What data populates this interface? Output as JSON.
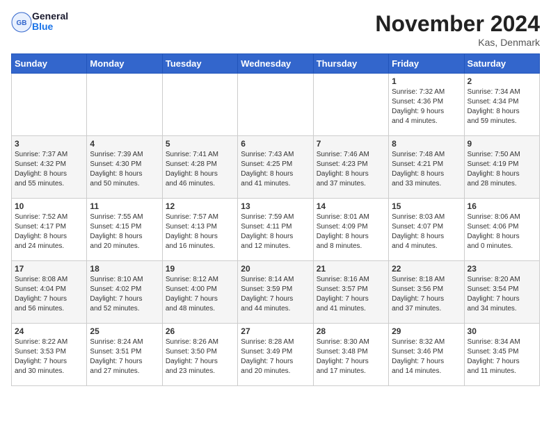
{
  "logo": {
    "line1": "General",
    "line2": "Blue"
  },
  "title": "November 2024",
  "location": "Kas, Denmark",
  "days_of_week": [
    "Sunday",
    "Monday",
    "Tuesday",
    "Wednesday",
    "Thursday",
    "Friday",
    "Saturday"
  ],
  "weeks": [
    [
      {
        "day": "",
        "info": ""
      },
      {
        "day": "",
        "info": ""
      },
      {
        "day": "",
        "info": ""
      },
      {
        "day": "",
        "info": ""
      },
      {
        "day": "",
        "info": ""
      },
      {
        "day": "1",
        "info": "Sunrise: 7:32 AM\nSunset: 4:36 PM\nDaylight: 9 hours\nand 4 minutes."
      },
      {
        "day": "2",
        "info": "Sunrise: 7:34 AM\nSunset: 4:34 PM\nDaylight: 8 hours\nand 59 minutes."
      }
    ],
    [
      {
        "day": "3",
        "info": "Sunrise: 7:37 AM\nSunset: 4:32 PM\nDaylight: 8 hours\nand 55 minutes."
      },
      {
        "day": "4",
        "info": "Sunrise: 7:39 AM\nSunset: 4:30 PM\nDaylight: 8 hours\nand 50 minutes."
      },
      {
        "day": "5",
        "info": "Sunrise: 7:41 AM\nSunset: 4:28 PM\nDaylight: 8 hours\nand 46 minutes."
      },
      {
        "day": "6",
        "info": "Sunrise: 7:43 AM\nSunset: 4:25 PM\nDaylight: 8 hours\nand 41 minutes."
      },
      {
        "day": "7",
        "info": "Sunrise: 7:46 AM\nSunset: 4:23 PM\nDaylight: 8 hours\nand 37 minutes."
      },
      {
        "day": "8",
        "info": "Sunrise: 7:48 AM\nSunset: 4:21 PM\nDaylight: 8 hours\nand 33 minutes."
      },
      {
        "day": "9",
        "info": "Sunrise: 7:50 AM\nSunset: 4:19 PM\nDaylight: 8 hours\nand 28 minutes."
      }
    ],
    [
      {
        "day": "10",
        "info": "Sunrise: 7:52 AM\nSunset: 4:17 PM\nDaylight: 8 hours\nand 24 minutes."
      },
      {
        "day": "11",
        "info": "Sunrise: 7:55 AM\nSunset: 4:15 PM\nDaylight: 8 hours\nand 20 minutes."
      },
      {
        "day": "12",
        "info": "Sunrise: 7:57 AM\nSunset: 4:13 PM\nDaylight: 8 hours\nand 16 minutes."
      },
      {
        "day": "13",
        "info": "Sunrise: 7:59 AM\nSunset: 4:11 PM\nDaylight: 8 hours\nand 12 minutes."
      },
      {
        "day": "14",
        "info": "Sunrise: 8:01 AM\nSunset: 4:09 PM\nDaylight: 8 hours\nand 8 minutes."
      },
      {
        "day": "15",
        "info": "Sunrise: 8:03 AM\nSunset: 4:07 PM\nDaylight: 8 hours\nand 4 minutes."
      },
      {
        "day": "16",
        "info": "Sunrise: 8:06 AM\nSunset: 4:06 PM\nDaylight: 8 hours\nand 0 minutes."
      }
    ],
    [
      {
        "day": "17",
        "info": "Sunrise: 8:08 AM\nSunset: 4:04 PM\nDaylight: 7 hours\nand 56 minutes."
      },
      {
        "day": "18",
        "info": "Sunrise: 8:10 AM\nSunset: 4:02 PM\nDaylight: 7 hours\nand 52 minutes."
      },
      {
        "day": "19",
        "info": "Sunrise: 8:12 AM\nSunset: 4:00 PM\nDaylight: 7 hours\nand 48 minutes."
      },
      {
        "day": "20",
        "info": "Sunrise: 8:14 AM\nSunset: 3:59 PM\nDaylight: 7 hours\nand 44 minutes."
      },
      {
        "day": "21",
        "info": "Sunrise: 8:16 AM\nSunset: 3:57 PM\nDaylight: 7 hours\nand 41 minutes."
      },
      {
        "day": "22",
        "info": "Sunrise: 8:18 AM\nSunset: 3:56 PM\nDaylight: 7 hours\nand 37 minutes."
      },
      {
        "day": "23",
        "info": "Sunrise: 8:20 AM\nSunset: 3:54 PM\nDaylight: 7 hours\nand 34 minutes."
      }
    ],
    [
      {
        "day": "24",
        "info": "Sunrise: 8:22 AM\nSunset: 3:53 PM\nDaylight: 7 hours\nand 30 minutes."
      },
      {
        "day": "25",
        "info": "Sunrise: 8:24 AM\nSunset: 3:51 PM\nDaylight: 7 hours\nand 27 minutes."
      },
      {
        "day": "26",
        "info": "Sunrise: 8:26 AM\nSunset: 3:50 PM\nDaylight: 7 hours\nand 23 minutes."
      },
      {
        "day": "27",
        "info": "Sunrise: 8:28 AM\nSunset: 3:49 PM\nDaylight: 7 hours\nand 20 minutes."
      },
      {
        "day": "28",
        "info": "Sunrise: 8:30 AM\nSunset: 3:48 PM\nDaylight: 7 hours\nand 17 minutes."
      },
      {
        "day": "29",
        "info": "Sunrise: 8:32 AM\nSunset: 3:46 PM\nDaylight: 7 hours\nand 14 minutes."
      },
      {
        "day": "30",
        "info": "Sunrise: 8:34 AM\nSunset: 3:45 PM\nDaylight: 7 hours\nand 11 minutes."
      }
    ]
  ]
}
